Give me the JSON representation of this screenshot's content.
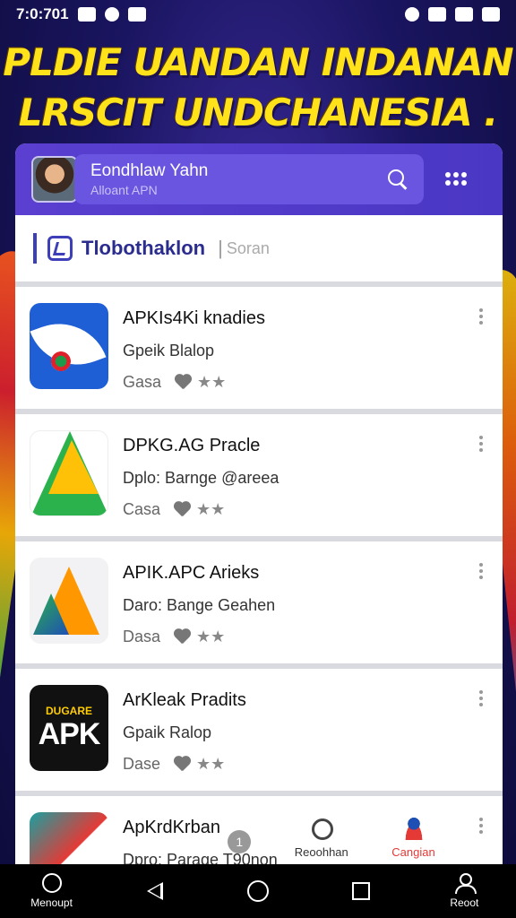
{
  "status_bar": {
    "time": "7:0:701"
  },
  "headline": {
    "line1": "PLDIE UANDAN INDANAN",
    "line2": "LRSCIT UNDCHANESIA ."
  },
  "top_bar": {
    "search_title": "Eondhlaw Yahn",
    "search_subtitle": "Alloant APN"
  },
  "brand_row": {
    "name": "Tlobothaklon",
    "separator": "|",
    "search_label": "Soran"
  },
  "apps": [
    {
      "name": "APKIs4Ki knadies",
      "developer": "Gpeik Blalop",
      "category": "Gasa",
      "icon": "eye-swirl-icon"
    },
    {
      "name": "DPKG.AG Pracle",
      "developer": "Dplo: Barnge @areea",
      "category": "Casa",
      "icon": "drive-triangle-icon"
    },
    {
      "name": "APIK.APC Arieks",
      "developer": "Daro: Bange Geahen",
      "category": "Dasa",
      "icon": "arrow-logo-icon"
    },
    {
      "name": "ArKleak Pradits",
      "developer": "Gpaik Ralop",
      "category": "Dase",
      "icon": "apk-box-icon",
      "icon_top": "DUGARE",
      "icon_main": "APK"
    },
    {
      "name": "ApKrdKrban",
      "developer": "Dpro: Parage T90non",
      "category": "",
      "icon": "mixed-logo-icon"
    }
  ],
  "rating_stars": "★★",
  "bottom_tabs": [
    {
      "label": "",
      "icon": "badge-icon",
      "badge": "1"
    },
    {
      "label": "Reoohhan",
      "icon": "search-icon"
    },
    {
      "label": "Cangian",
      "icon": "person-icon"
    }
  ],
  "nav_bar": {
    "left_label": "Menoupt",
    "right_label": "Reoot"
  },
  "colors": {
    "accent_purple": "#5a3fd0",
    "headline_yellow": "#ffe21a",
    "active_tab_red": "#e53935"
  }
}
